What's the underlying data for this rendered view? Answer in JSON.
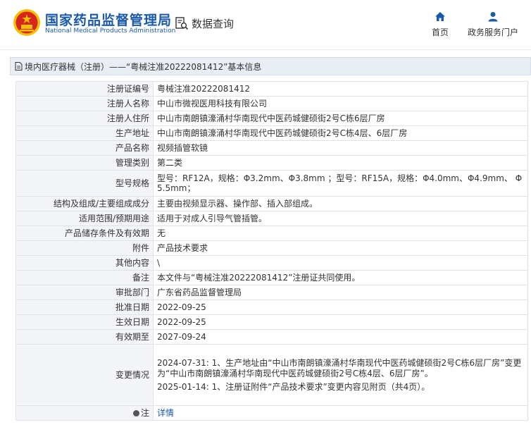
{
  "header": {
    "brand_cn": "国家药品监督管理局",
    "brand_en": "National Medical Products Administration",
    "query_label": "数据查询",
    "nav": [
      {
        "label": "首页",
        "icon": "home-icon"
      },
      {
        "label": "政务服务门户",
        "icon": "user-icon"
      }
    ]
  },
  "title": "境内医疗器械（注册）——“粤械注准20222081412”基本信息",
  "rows": [
    {
      "label": "注册证编号",
      "value": "粤械注准20222081412"
    },
    {
      "label": "注册人名称",
      "value": "中山市微视医用科技有限公司"
    },
    {
      "label": "注册人住所",
      "value": "中山市南朗镇濠涌村华南现代中医药城健硕街2号C栋6层厂房"
    },
    {
      "label": "生产地址",
      "value": "中山市南朗镇濠涌村华南现代中医药城健硕街2号C栋4层、6层厂房"
    },
    {
      "label": "产品名称",
      "value": "视频插管软镜"
    },
    {
      "label": "管理类别",
      "value": "第二类"
    },
    {
      "label": "型号规格",
      "value": "型号：RF12A，规格：Φ3.2mm、Φ3.8mm ；型号：RF15A，规格：Φ4.0mm、Φ4.9mm、 Φ5.5mm；"
    },
    {
      "label": "结构及组成/主要组成成分",
      "value": "主要由视频显示器、操作部、插入部组成。"
    },
    {
      "label": "适用范围/预期用途",
      "value": "适用于对成人引导气管插管。"
    },
    {
      "label": "产品储存条件及有效期",
      "value": "无"
    },
    {
      "label": "附件",
      "value": "产品技术要求"
    },
    {
      "label": "其他内容",
      "value": "\\"
    },
    {
      "label": "备注",
      "value": "本文件与“粤械注准20222081412”注册证共同使用。"
    },
    {
      "label": "审批部门",
      "value": "广东省药品监督管理局"
    },
    {
      "label": "批准日期",
      "value": "2022-09-25"
    },
    {
      "label": "生效日期",
      "value": "2022-09-25"
    },
    {
      "label": "有效期至",
      "value": "2027-09-24"
    }
  ],
  "changes": {
    "label": "变更情况",
    "entries": [
      "2024-07-31: 1、生产地址由“中山市南朗镇濠涌村华南现代中医药城健硕街2号C栋6层厂房”变更为“中山市南朗镇濠涌村华南现代中医药城健硕街2号C栋4层、6层厂房”。",
      "2025-01-14: 1、注册证附件“产品技术要求”变更内容见附页（共4页）。"
    ]
  },
  "note": {
    "label": "注",
    "link": "详情"
  },
  "colors": {
    "brand": "#1a5aa8",
    "logo_red": "#d7261d",
    "logo_gold": "#f5c000"
  }
}
